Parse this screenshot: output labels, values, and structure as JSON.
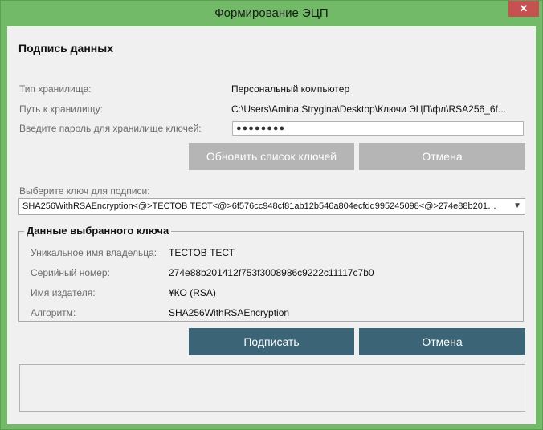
{
  "window": {
    "title": "Формирование ЭЦП",
    "close_glyph": "✕"
  },
  "heading": "Подпись данных",
  "storage": {
    "type_label": "Тип хранилища:",
    "type_value": "Персональный компьютер",
    "path_label": "Путь к хранилищу:",
    "path_value": "C:\\Users\\Amina.Strygina\\Desktop\\Ключи ЭЦП\\фл\\RSA256_6f...",
    "password_label": "Введите пароль для хранилище ключей:",
    "password_value": "●●●●●●●●"
  },
  "buttons": {
    "refresh_keys": "Обновить список ключей",
    "cancel_top": "Отмена",
    "sign": "Подписать",
    "cancel_bottom": "Отмена"
  },
  "key_select": {
    "label": "Выберите ключ для подписи:",
    "selected": "SHA256WithRSAEncryption<@>ТЕСТОВ ТЕСТ<@>6f576cc948cf81ab12b546a804ecfdd995245098<@>274e88b201412f...",
    "arrow": "▼"
  },
  "key_details": {
    "group_title": "Данные выбранного ключа",
    "owner_label": "Уникальное имя владельца:",
    "owner_value": "ТЕСТОВ ТЕСТ",
    "serial_label": "Серийный номер:",
    "serial_value": "274e88b201412f753f3008986c9222c11117c7b0",
    "issuer_label": "Имя издателя:",
    "issuer_value": "ҰКО (RSA)",
    "algorithm_label": "Алгоритм:",
    "algorithm_value": "SHA256WithRSAEncryption"
  },
  "colors": {
    "frame": "#72b968",
    "close_button": "#c75050",
    "primary_button": "#3b6577",
    "disabled_button": "#b5b5b5",
    "client_bg": "#f0f0f0"
  },
  "icons": {
    "close": "close-icon",
    "dropdown": "chevron-down-icon"
  }
}
